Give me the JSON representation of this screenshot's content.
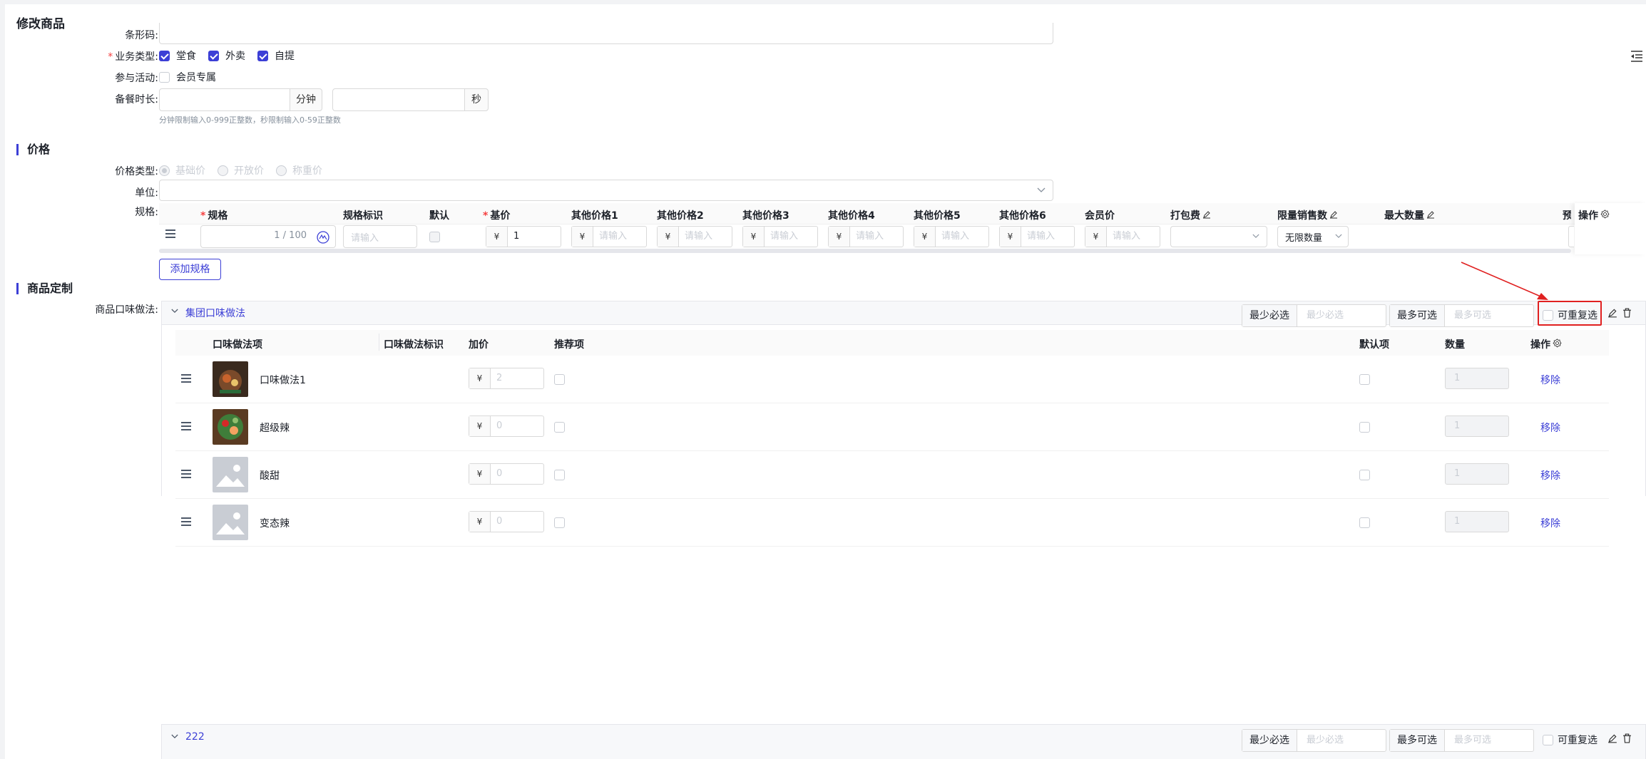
{
  "page": {
    "title": "修改商品"
  },
  "basic": {
    "barcode_label": "条形码:",
    "biz_label": "业务类型:",
    "biz_options": [
      {
        "label": "堂食",
        "checked": true
      },
      {
        "label": "外卖",
        "checked": true
      },
      {
        "label": "自提",
        "checked": true
      }
    ],
    "activity_label": "参与活动:",
    "activity_option": {
      "label": "会员专属",
      "checked": false
    },
    "prep_label": "备餐时长:",
    "prep_min_unit": "分钟",
    "prep_sec_unit": "秒",
    "prep_hint": "分钟限制输入0-999正整数，秒限制输入0-59正整数"
  },
  "price": {
    "section_title": "价格",
    "type_label": "价格类型:",
    "types": [
      "基础价",
      "开放价",
      "称重价"
    ],
    "unit_label": "单位:",
    "spec_label": "规格:",
    "spec_headers": [
      "规格",
      "规格标识",
      "默认",
      "基价",
      "其他价格1",
      "其他价格2",
      "其他价格3",
      "其他价格4",
      "其他价格5",
      "其他价格6",
      "会员价",
      "打包费",
      "限量销售数",
      "最大数量",
      "预",
      "操作"
    ],
    "spec_row": {
      "name_count": "1 / 100",
      "ident_placeholder": "请输入",
      "currency": "¥",
      "base_price": "1",
      "other_placeholder": "请输入",
      "member_placeholder": "请输入",
      "limit_value": "无限数量"
    },
    "add_spec": "添加规格"
  },
  "custom": {
    "section_title": "商品定制",
    "taste_label": "商品口味做法:",
    "groups": [
      {
        "name": "集团口味做法",
        "min_label": "最少必选",
        "min_placeholder": "最少必选",
        "max_label": "最多可选",
        "max_placeholder": "最多可选",
        "repeat_label": "可重复选"
      },
      {
        "name": "222",
        "min_label": "最少必选",
        "min_placeholder": "最少必选",
        "max_label": "最多可选",
        "max_placeholder": "最多可选",
        "repeat_label": "可重复选"
      }
    ],
    "table_headers": [
      "口味做法项",
      "口味做法标识",
      "加价",
      "推荐项",
      "默认项",
      "数量",
      "操作"
    ],
    "items": [
      {
        "name": "口味做法1",
        "price": "2",
        "qty": "1",
        "action": "移除"
      },
      {
        "name": "超级辣",
        "price": "0",
        "qty": "1",
        "action": "移除"
      },
      {
        "name": "酸甜",
        "price": "0",
        "qty": "1",
        "action": "移除"
      },
      {
        "name": "变态辣",
        "price": "0",
        "qty": "1",
        "action": "移除"
      }
    ],
    "currency": "¥"
  },
  "colors": {
    "accent": "#3c3fd6",
    "required": "#f53f3f",
    "highlight": "#e02020"
  }
}
